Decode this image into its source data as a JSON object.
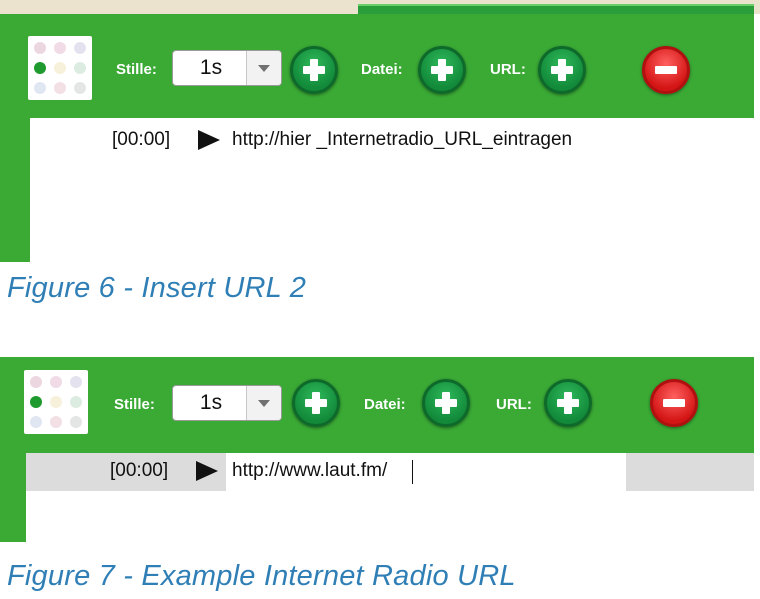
{
  "colors": {
    "panel_green": "#3aaa35",
    "add_button_green": "#1a9a45",
    "remove_button_red": "#e02020",
    "caption_blue": "#2f7fb6"
  },
  "figure6": {
    "toolbar": {
      "silence_label": "Stille:",
      "silence_value": "1s",
      "file_label": "Datei:",
      "url_label": "URL:"
    },
    "entry": {
      "time": "[00:00]",
      "url": "http://hier _Internetradio_URL_eintragen"
    },
    "caption": "Figure 6 - Insert URL 2"
  },
  "figure7": {
    "toolbar": {
      "silence_label": "Stille:",
      "silence_value": "1s",
      "file_label": "Datei:",
      "url_label": "URL:"
    },
    "entry": {
      "time": "[00:00]",
      "url": "http://www.laut.fm/"
    },
    "caption": "Figure 7 - Example Internet Radio URL"
  }
}
